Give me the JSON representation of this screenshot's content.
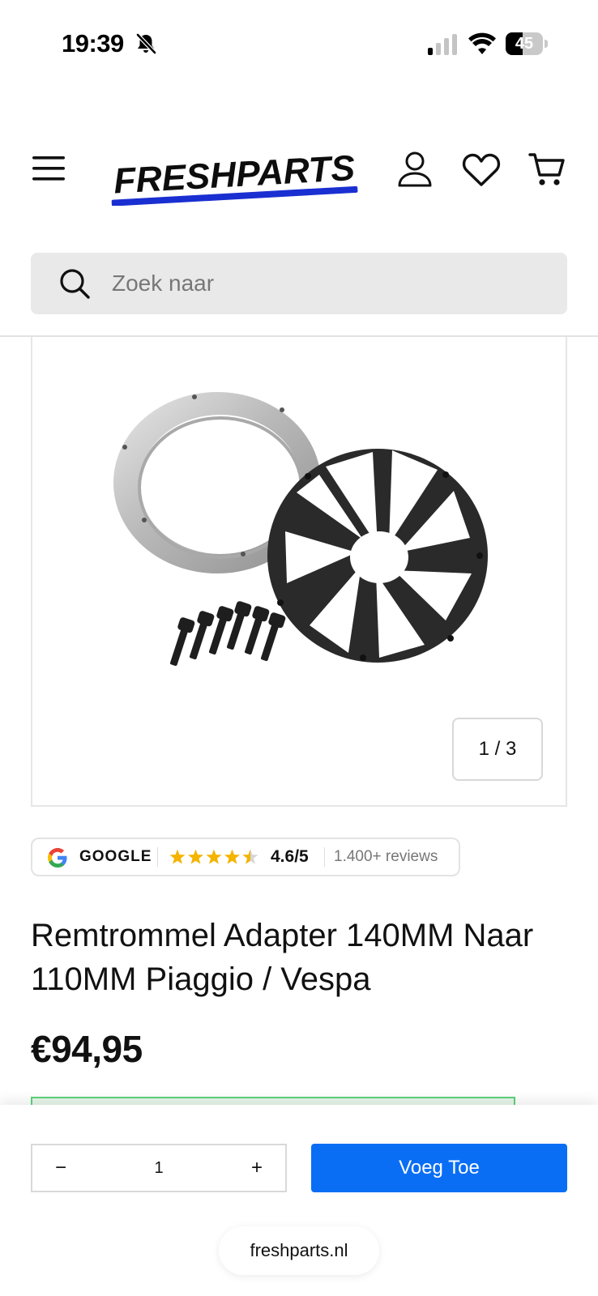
{
  "status_bar": {
    "time": "19:39",
    "battery_level": "45",
    "icons": [
      "bell-slash-icon",
      "signal-icon",
      "wifi-icon",
      "battery-icon"
    ]
  },
  "header": {
    "logo_text": "FRESHPARTS",
    "icons": [
      "menu-icon",
      "user-icon",
      "heart-icon",
      "cart-icon"
    ],
    "brand_color": "#1a2fd1"
  },
  "search": {
    "placeholder": "Zoek naar"
  },
  "gallery": {
    "counter": "1 / 3"
  },
  "reviews": {
    "source": "GOOGLE",
    "stars": 4.5,
    "rating": "4.6/5",
    "count": "1.400+ reviews",
    "star_color": "#f4b400"
  },
  "product": {
    "title": "Remtrommel Adapter 140MM Naar 110MM Piaggio / Vespa",
    "price": "€94,95"
  },
  "cart_bar": {
    "minus": "−",
    "quantity": "1",
    "plus": "+",
    "add_label": "Voeg Toe",
    "accent_color": "#0a6ef5"
  },
  "browser": {
    "url": "freshparts.nl"
  }
}
